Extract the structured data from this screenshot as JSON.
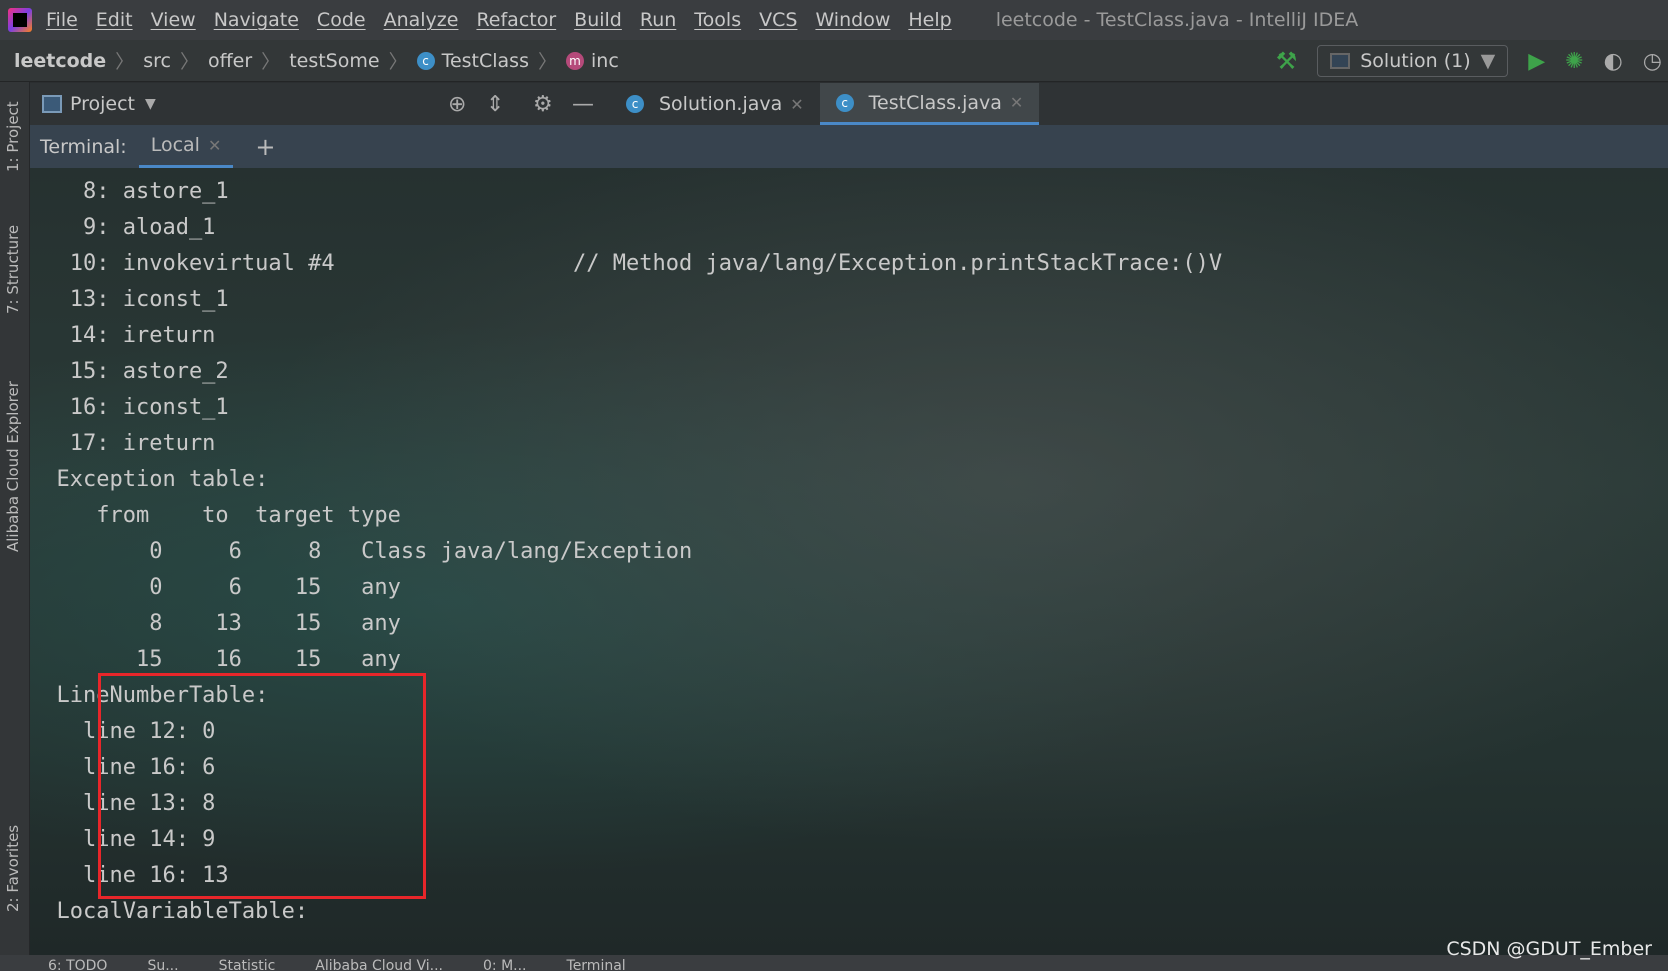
{
  "menubar": {
    "items": [
      "File",
      "Edit",
      "View",
      "Navigate",
      "Code",
      "Analyze",
      "Refactor",
      "Build",
      "Run",
      "Tools",
      "VCS",
      "Window",
      "Help"
    ],
    "title": "leetcode - TestClass.java - IntelliJ IDEA"
  },
  "breadcrumb": [
    "leetcode",
    "src",
    "offer",
    "testSome",
    "TestClass",
    "inc"
  ],
  "run_config": "Solution (1)",
  "toolbar": {
    "project_label": "Project"
  },
  "editor_tabs": [
    {
      "label": "Solution.java",
      "active": false
    },
    {
      "label": "TestClass.java",
      "active": true
    }
  ],
  "sidebar": {
    "items": [
      "1: Project",
      "7: Structure",
      "Alibaba Cloud Explorer",
      "2: Favorites"
    ]
  },
  "terminal": {
    "label": "Terminal:",
    "tab": "Local",
    "lines": [
      "    8: astore_1",
      "    9: aload_1",
      "   10: invokevirtual #4                  // Method java/lang/Exception.printStackTrace:()V",
      "   13: iconst_1",
      "   14: ireturn",
      "   15: astore_2",
      "   16: iconst_1",
      "   17: ireturn",
      "  Exception table:",
      "     from    to  target type",
      "         0     6     8   Class java/lang/Exception",
      "         0     6    15   any",
      "         8    13    15   any",
      "        15    16    15   any",
      "  LineNumberTable:",
      "    line 12: 0",
      "    line 16: 6",
      "    line 13: 8",
      "    line 14: 9",
      "    line 16: 13",
      "  LocalVariableTable:"
    ]
  },
  "statusbar": [
    "6: TODO",
    "Su...",
    "Statistic",
    "Alibaba Cloud Vi...",
    "0: M...",
    "Terminal"
  ],
  "watermark": "CSDN @GDUT_Ember",
  "colors": {
    "highlight_box": "#e8262a",
    "accent": "#4a88c7",
    "run_green": "#3ea34a"
  }
}
